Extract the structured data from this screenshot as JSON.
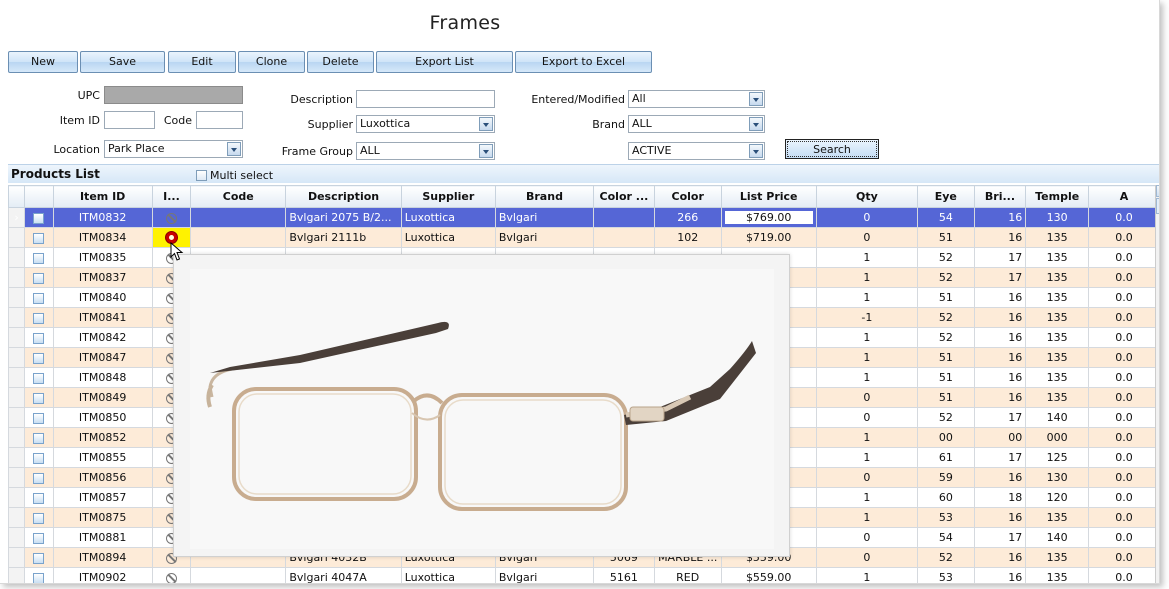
{
  "title": "Frames",
  "toolbar": {
    "new": "New",
    "save": "Save",
    "edit": "Edit",
    "clone": "Clone",
    "delete": "Delete",
    "export_list": "Export List",
    "export_excel": "Export to Excel"
  },
  "filters": {
    "upc_label": "UPC",
    "upc_value": "",
    "item_id_label": "Item ID",
    "item_id_value": "",
    "code_label": "Code",
    "code_value": "",
    "location_label": "Location",
    "location_value": "Park Place",
    "description_label": "Description",
    "description_value": "",
    "supplier_label": "Supplier",
    "supplier_value": "Luxottica",
    "frame_group_label": "Frame Group",
    "frame_group_value": "ALL",
    "entered_modified_label": "Entered/Modified",
    "entered_modified_value": "All",
    "brand_label": "Brand",
    "brand_value": "ALL",
    "status_value": "ACTIVE",
    "search_label": "Search"
  },
  "products_list": {
    "title": "Products List",
    "multi_select_label": "Multi select"
  },
  "grid": {
    "columns": [
      "Item ID",
      "I...",
      "Code",
      "Description",
      "Supplier",
      "Brand",
      "Color ...",
      "Color",
      "List Price",
      "Qty",
      "Eye",
      "Bri...",
      "Temple",
      "A"
    ],
    "rows": [
      {
        "item_id": "ITM0832",
        "code": "",
        "description": "Bvlgari 2075 B/2...",
        "supplier": "Luxottica",
        "brand": "Bvlgari",
        "color_code": "",
        "color": "266",
        "price": "$769.00",
        "qty": "0",
        "eye": "54",
        "bridge": "16",
        "temple": "130",
        "a": "0.0"
      },
      {
        "item_id": "ITM0834",
        "code": "",
        "description": "Bvlgari  2111b",
        "supplier": "Luxottica",
        "brand": "Bvlgari",
        "color_code": "",
        "color": "102",
        "price": "$719.00",
        "qty": "0",
        "eye": "51",
        "bridge": "16",
        "temple": "135",
        "a": "0.0"
      },
      {
        "item_id": "ITM0835",
        "code": "",
        "description": "",
        "supplier": "",
        "brand": "",
        "color_code": "",
        "color": "",
        "price": "",
        "qty": "1",
        "eye": "52",
        "bridge": "17",
        "temple": "135",
        "a": "0.0"
      },
      {
        "item_id": "ITM0837",
        "code": "",
        "description": "",
        "supplier": "",
        "brand": "",
        "color_code": "",
        "color": "",
        "price": "",
        "qty": "1",
        "eye": "52",
        "bridge": "17",
        "temple": "135",
        "a": "0.0"
      },
      {
        "item_id": "ITM0840",
        "code": "",
        "description": "",
        "supplier": "",
        "brand": "",
        "color_code": "",
        "color": "",
        "price": "",
        "qty": "1",
        "eye": "51",
        "bridge": "16",
        "temple": "135",
        "a": "0.0"
      },
      {
        "item_id": "ITM0841",
        "code": "",
        "description": "",
        "supplier": "",
        "brand": "",
        "color_code": "",
        "color": "",
        "price": "",
        "qty": "-1",
        "eye": "52",
        "bridge": "16",
        "temple": "135",
        "a": "0.0"
      },
      {
        "item_id": "ITM0842",
        "code": "",
        "description": "",
        "supplier": "",
        "brand": "",
        "color_code": "",
        "color": "",
        "price": "",
        "qty": "1",
        "eye": "52",
        "bridge": "16",
        "temple": "135",
        "a": "0.0"
      },
      {
        "item_id": "ITM0847",
        "code": "",
        "description": "",
        "supplier": "",
        "brand": "",
        "color_code": "",
        "color": "",
        "price": "",
        "qty": "1",
        "eye": "51",
        "bridge": "16",
        "temple": "135",
        "a": "0.0"
      },
      {
        "item_id": "ITM0848",
        "code": "",
        "description": "",
        "supplier": "",
        "brand": "",
        "color_code": "",
        "color": "",
        "price": "",
        "qty": "1",
        "eye": "51",
        "bridge": "16",
        "temple": "135",
        "a": "0.0"
      },
      {
        "item_id": "ITM0849",
        "code": "",
        "description": "",
        "supplier": "",
        "brand": "",
        "color_code": "",
        "color": "",
        "price": "",
        "qty": "0",
        "eye": "51",
        "bridge": "16",
        "temple": "135",
        "a": "0.0"
      },
      {
        "item_id": "ITM0850",
        "code": "",
        "description": "",
        "supplier": "",
        "brand": "",
        "color_code": "",
        "color": "",
        "price": "",
        "qty": "0",
        "eye": "52",
        "bridge": "17",
        "temple": "140",
        "a": "0.0"
      },
      {
        "item_id": "ITM0852",
        "code": "",
        "description": "",
        "supplier": "",
        "brand": "",
        "color_code": "",
        "color": "",
        "price": "",
        "qty": "1",
        "eye": "00",
        "bridge": "00",
        "temple": "000",
        "a": "0.0"
      },
      {
        "item_id": "ITM0855",
        "code": "",
        "description": "",
        "supplier": "",
        "brand": "",
        "color_code": "",
        "color": "",
        "price": "",
        "qty": "1",
        "eye": "61",
        "bridge": "17",
        "temple": "125",
        "a": "0.0"
      },
      {
        "item_id": "ITM0856",
        "code": "",
        "description": "",
        "supplier": "",
        "brand": "",
        "color_code": "",
        "color": "",
        "price": "",
        "qty": "0",
        "eye": "59",
        "bridge": "16",
        "temple": "130",
        "a": "0.0"
      },
      {
        "item_id": "ITM0857",
        "code": "",
        "description": "",
        "supplier": "",
        "brand": "",
        "color_code": "",
        "color": "",
        "price": "",
        "qty": "1",
        "eye": "60",
        "bridge": "18",
        "temple": "120",
        "a": "0.0"
      },
      {
        "item_id": "ITM0875",
        "code": "",
        "description": "",
        "supplier": "",
        "brand": "",
        "color_code": "",
        "color": "",
        "price": "",
        "qty": "1",
        "eye": "53",
        "bridge": "16",
        "temple": "135",
        "a": "0.0"
      },
      {
        "item_id": "ITM0881",
        "code": "",
        "description": "",
        "supplier": "",
        "brand": "",
        "color_code": "",
        "color": "",
        "price": "",
        "qty": "0",
        "eye": "54",
        "bridge": "17",
        "temple": "140",
        "a": "0.0"
      },
      {
        "item_id": "ITM0894",
        "code": "",
        "description": "Bvlgari 4032B",
        "supplier": "Luxottica",
        "brand": "Bvlgari",
        "color_code": "5069",
        "color": "MARBLE ...",
        "price": "$559.00",
        "qty": "0",
        "eye": "52",
        "bridge": "16",
        "temple": "135",
        "a": "0.0"
      },
      {
        "item_id": "ITM0902",
        "code": "",
        "description": "Bvlgari 4047A",
        "supplier": "Luxottica",
        "brand": "Bvlgari",
        "color_code": "5161",
        "color": "RED",
        "price": "$559.00",
        "qty": "1",
        "eye": "53",
        "bridge": "16",
        "temple": "135",
        "a": "0.0"
      }
    ]
  },
  "colors": {
    "selected_row": "#5566d6",
    "alt_row": "#fdebd8",
    "image_highlight": "#fff200"
  },
  "icons": {
    "no_image": "no-image-icon",
    "camera": "camera-icon",
    "row_selector": "row-pointer-icon"
  }
}
